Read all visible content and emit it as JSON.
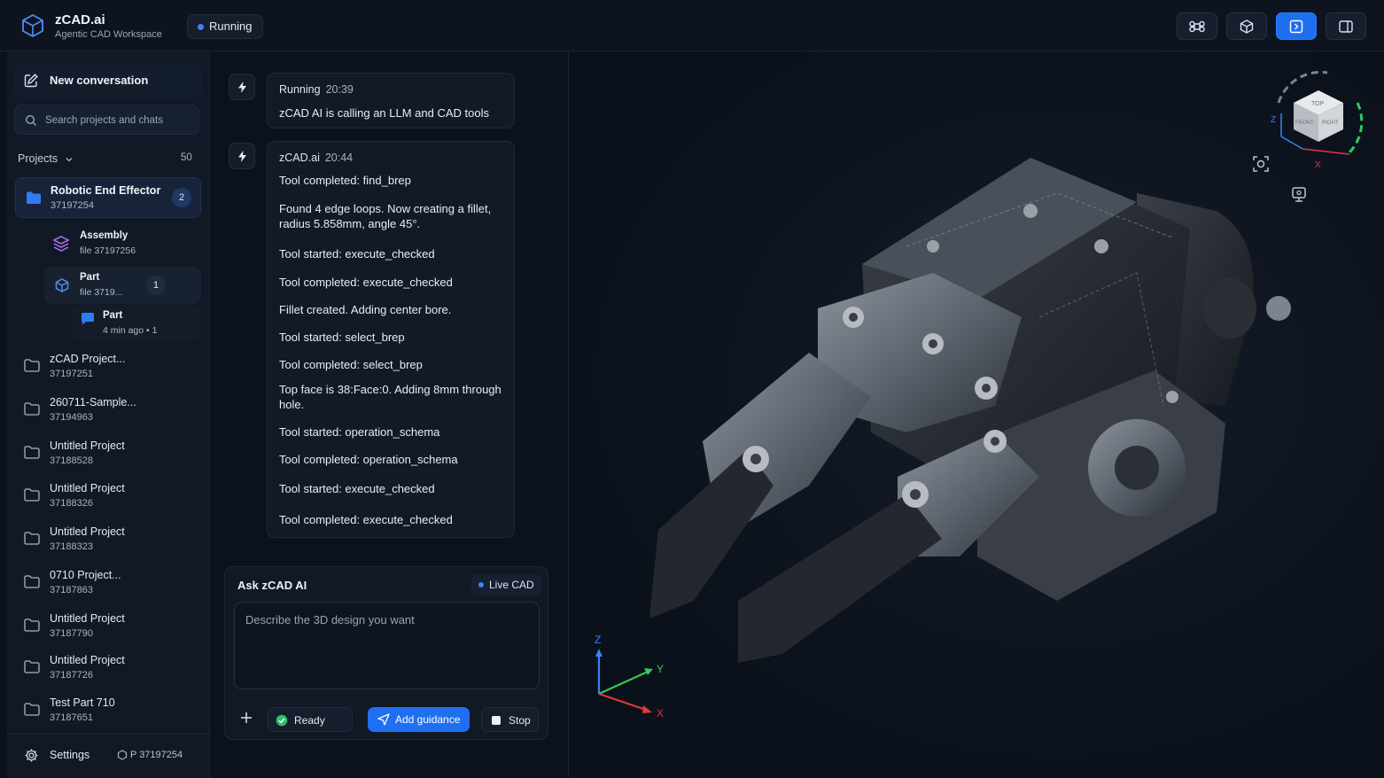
{
  "app": {
    "name": "zCAD.ai",
    "subtitle": "Agentic CAD Workspace",
    "status": "Running"
  },
  "toolbar": {
    "buttons": [
      "command-icon",
      "cube-icon",
      "code-view-icon",
      "panel-toggle-icon"
    ],
    "active": "code-view-icon",
    "accent": "#1e6ff0"
  },
  "sidebar": {
    "new_conversation": "New conversation",
    "search_placeholder": "Search projects and chats",
    "projects_label": "Projects",
    "projects_count": "50",
    "active_project": {
      "name": "Robotic End Effector",
      "id": "37197254",
      "badge": "2",
      "children": [
        {
          "title": "Assembly",
          "sub": "file 37197256",
          "icon": "layers-icon"
        },
        {
          "title": "Part",
          "sub": "file 3719...",
          "icon": "cube-icon",
          "badge": "1"
        },
        {
          "title": "Part",
          "sub": "4 min ago  •  1",
          "icon": "chat-icon"
        }
      ]
    },
    "projects": [
      {
        "name": "zCAD Project...",
        "id": "37197251"
      },
      {
        "name": "260711-Sample...",
        "id": "37194963"
      },
      {
        "name": "Untitled Project",
        "id": "37188528"
      },
      {
        "name": "Untitled Project",
        "id": "37188326"
      },
      {
        "name": "Untitled Project",
        "id": "37188323"
      },
      {
        "name": "0710 Project...",
        "id": "37187863"
      },
      {
        "name": "Untitled Project",
        "id": "37187790"
      },
      {
        "name": "Untitled Project",
        "id": "37187726"
      },
      {
        "name": "Test Part 710",
        "id": "37187651"
      }
    ],
    "settings_label": "Settings",
    "project_id": "P 37197254"
  },
  "chat": {
    "messages": [
      {
        "author": "Running",
        "time": "20:39",
        "lines": [
          "zCAD AI is calling an LLM and CAD tools"
        ]
      },
      {
        "author": "zCAD.ai",
        "time": "20:44",
        "lines": [
          "Tool completed: find_brep",
          "Found 4 edge loops. Now creating a fillet, radius 5.858mm, angle 45°.",
          "Tool started: execute_checked",
          "Tool completed: execute_checked",
          "Fillet created. Adding center bore.",
          "Tool started: select_brep",
          "Tool completed: select_brep",
          "Top face is 38:Face:0. Adding 8mm through hole.",
          "Tool started: operation_schema",
          "Tool completed: operation_schema",
          "Tool started: execute_checked",
          "Tool completed: execute_checked"
        ]
      }
    ],
    "composer": {
      "title": "Ask zCAD AI",
      "live_label": "Live CAD",
      "placeholder": "Describe the 3D design you want",
      "ready_label": "Ready",
      "guidance_label": "Add guidance",
      "stop_label": "Stop"
    }
  },
  "viewport": {
    "axis_labels": {
      "x": "X",
      "y": "Y",
      "z": "Z"
    },
    "cube_faces": [
      "TOP",
      "FRONT",
      "RIGHT"
    ],
    "colors": {
      "x": "#e0383e",
      "y": "#34c759",
      "z": "#3b82f6"
    }
  }
}
